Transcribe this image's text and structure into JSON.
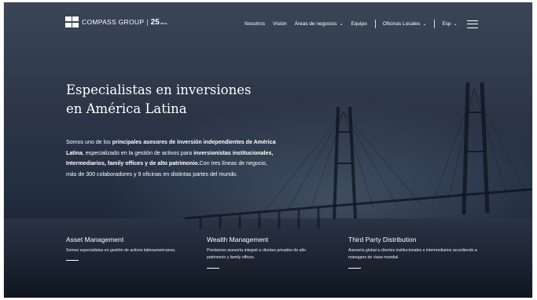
{
  "brand": {
    "name": "COMPASS GROUP",
    "anniversary": "25",
    "anniversary_suffix": "años"
  },
  "nav": {
    "items": [
      "Nosotros",
      "Visión",
      "Áreas de negocios",
      "Equipo",
      "Oficinas Locales",
      "Esp"
    ],
    "dropdown_icon": "chevron-down-icon",
    "menu_icon": "hamburger-icon"
  },
  "hero": {
    "title_line1": "Especialistas en inversiones",
    "title_line2": "en América Latina",
    "p1": "Somos uno de los ",
    "b1": "principales asesores de inversión independientes de América Latina",
    "p2": ", especializado en la gestión de activos para ",
    "b2": "inversionistas institucionales, Intermediarios, family offices y de alto patrimonio.",
    "p3": "Con tres líneas de negocio, más de 300 colaboradores y 9 oficinas en distintas partes del mundo."
  },
  "columns": [
    {
      "title": "Asset Management",
      "text": "Somos especialistas en gestión de activos latinoamericanos."
    },
    {
      "title": "Wealth Management",
      "text": "Prestamos asesoría integral a clientes privados de alto patrimonio y family offices."
    },
    {
      "title": "Third Party Distribution",
      "text": "Asesoría global a clientes institucionales e intermediarios accediendo a managers de clase mundial"
    }
  ]
}
